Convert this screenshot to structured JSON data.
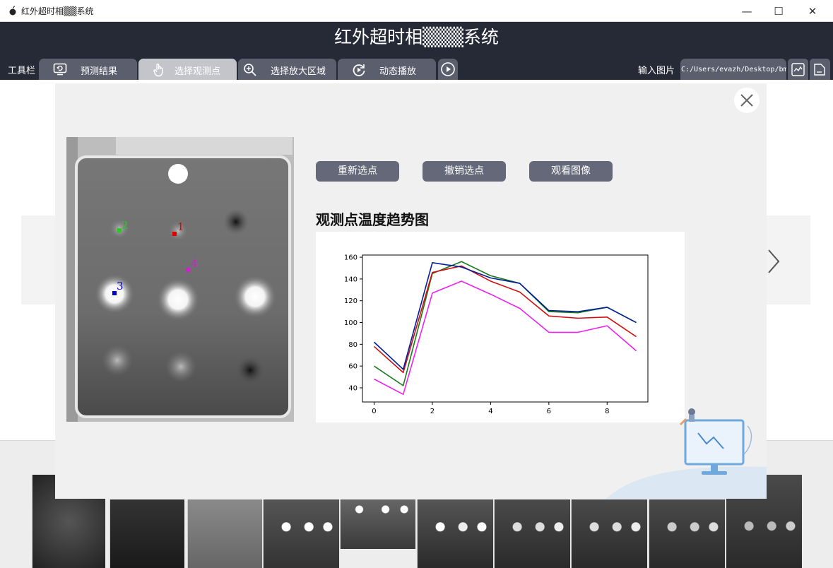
{
  "window": {
    "title": "红外超时相▒▒系统",
    "minimize": "—",
    "maximize": "☐",
    "close": "✕"
  },
  "header": {
    "title": "红外超时相▒▒▒系统",
    "toolbar_label": "工具栏",
    "buttons": [
      {
        "label": "预测结果",
        "icon": "monitor-refresh-icon",
        "active": false
      },
      {
        "label": "选择观测点",
        "icon": "hand-pointer-icon",
        "active": true
      },
      {
        "label": "选择放大区域",
        "icon": "zoom-in-icon",
        "active": false
      },
      {
        "label": "动态播放",
        "icon": "replay-icon",
        "active": false
      }
    ],
    "play_icon": "play-circle-icon",
    "input_label": "输入图片",
    "input_path": "C:/Users/evazh/Desktop/bmp",
    "chart_icon": "chart-image-icon",
    "folder_icon": "open-file-icon"
  },
  "modal": {
    "close_icon": "close-icon",
    "buttons": {
      "reselect": "重新选点",
      "undo": "撤销选点",
      "view": "观看图像"
    },
    "points": [
      {
        "label": "1",
        "color": "#e00000"
      },
      {
        "label": "2",
        "color": "#22cc22"
      },
      {
        "label": "3",
        "color": "#0000c0"
      },
      {
        "label": "4",
        "color": "#d020d0"
      }
    ],
    "chart_title": "观测点温度趋势图"
  },
  "colors": {
    "header_bg": "#262a36",
    "toolbar_btn": "#5a5e6d",
    "toolbar_btn_active": "#c3c5cb",
    "action_btn": "#646878"
  },
  "chart_data": {
    "type": "line",
    "title": "",
    "xlabel": "",
    "ylabel": "",
    "x": [
      0,
      1,
      2,
      3,
      4,
      5,
      6,
      7,
      8,
      9
    ],
    "xticks": [
      "0",
      "2",
      "4",
      "6",
      "8"
    ],
    "yticks": [
      "40",
      "60",
      "80",
      "100",
      "120",
      "140",
      "160"
    ],
    "xlim": [
      -0.4,
      9.4
    ],
    "ylim": [
      27,
      162
    ],
    "grid": false,
    "series": [
      {
        "color": "#1a7a1a",
        "values": [
          60,
          42,
          145,
          156,
          143,
          136,
          110,
          109,
          114,
          100
        ]
      },
      {
        "color": "#d01010",
        "values": [
          78,
          54,
          146,
          152,
          138,
          128,
          106,
          104,
          105,
          87
        ]
      },
      {
        "color": "#ee22ee",
        "values": [
          48,
          34,
          127,
          138,
          126,
          113,
          91,
          91,
          97,
          74
        ]
      },
      {
        "color": "#001e9a",
        "values": [
          82,
          57,
          155,
          151,
          141,
          136,
          111,
          110,
          114,
          100
        ]
      }
    ]
  }
}
